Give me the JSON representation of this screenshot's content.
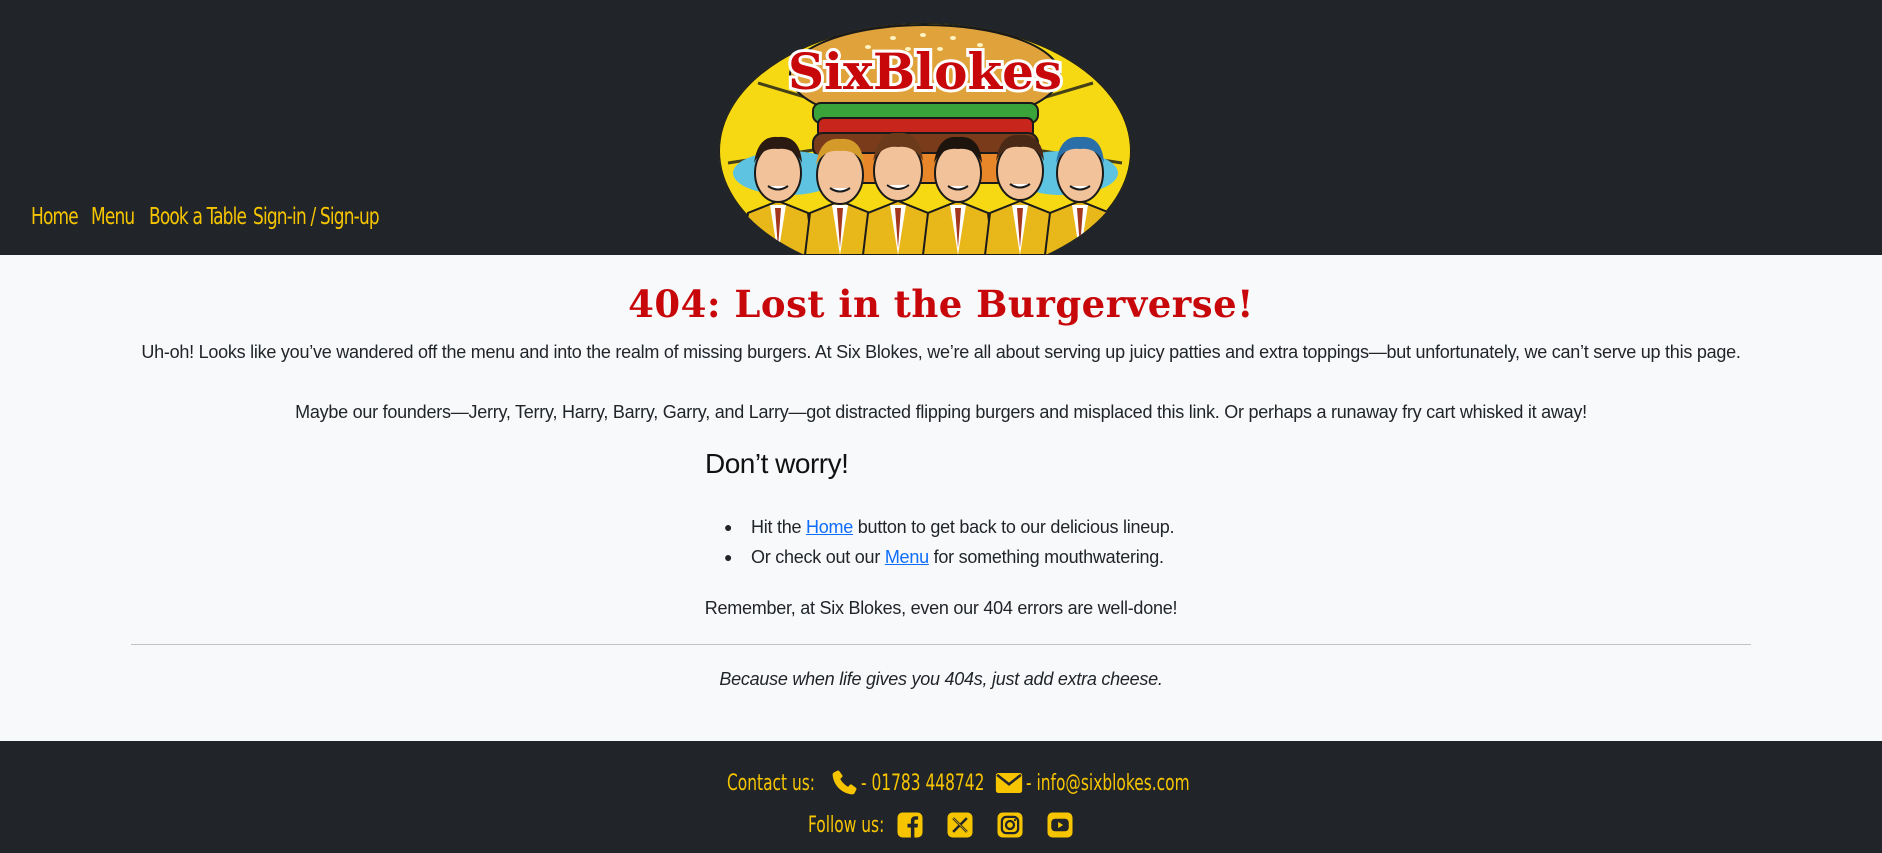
{
  "header": {
    "nav": [
      {
        "label": "Home"
      },
      {
        "label": "Menu"
      },
      {
        "label": "Book a Table"
      },
      {
        "label": "Sign-in / Sign-up"
      }
    ],
    "logo_text": "SixBlokes"
  },
  "main": {
    "title": "404: Lost in the Burgerverse!",
    "paragraph1": "Uh-oh! Looks like you’ve wandered off the menu and into the realm of missing burgers. At Six Blokes, we’re all about serving up juicy patties and extra toppings—but unfortunately, we can’t serve up this page.",
    "paragraph2": "Maybe our founders—Jerry, Terry, Harry, Barry, Garry, and Larry—got distracted flipping burgers and misplaced this link. Or perhaps a runaway fry cart whisked it away!",
    "subheading": "Don’t worry!",
    "list": [
      {
        "before": "Hit the ",
        "link": "Home",
        "after": " button to get back to our delicious lineup."
      },
      {
        "before": "Or check out our ",
        "link": "Menu",
        "after": " for something mouthwatering."
      }
    ],
    "remember": "Remember, at Six Blokes, even our 404 errors are well-done!",
    "tagline": "Because when life gives you 404s, just add extra cheese."
  },
  "footer": {
    "contact_label": "Contact us:",
    "phone": "- 01783 448742",
    "email": "- info@sixblokes.com",
    "follow_label": "Follow us:",
    "social_icons": [
      "facebook-icon",
      "x-twitter-icon",
      "instagram-icon",
      "youtube-icon"
    ]
  },
  "colors": {
    "header_bg": "#212529",
    "accent_yellow": "#f7c500",
    "title_red": "#c8070b",
    "link_blue": "#0d6efd",
    "page_bg": "#f8f9fa"
  }
}
